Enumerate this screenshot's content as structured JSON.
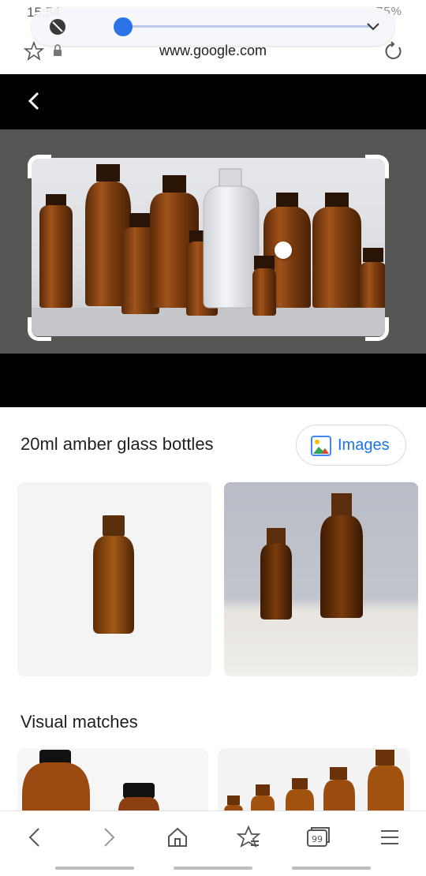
{
  "status_bar": {
    "time": "15:54",
    "battery": "75%"
  },
  "brightness_panel": {
    "level_percent": 2,
    "auto_icon": "auto-brightness-off-icon",
    "expand_icon": "chevron-down-icon"
  },
  "address_bar": {
    "url": "www.google.com",
    "favorite_icon": "star-icon",
    "lock_icon": "lock-icon",
    "reload_icon": "reload-icon"
  },
  "lens": {
    "back_icon": "back-arrow-icon"
  },
  "results": {
    "title": "20ml amber glass bottles",
    "images_button": "Images",
    "visual_matches_title": "Visual matches"
  },
  "bottom_nav": {
    "items": [
      "back-icon",
      "forward-icon",
      "home-icon",
      "bookmarks-icon",
      "tabs-icon",
      "menu-icon"
    ],
    "tab_count": "99"
  },
  "colors": {
    "accent": "#1a73e8",
    "slider": "#2c73ea",
    "amber": "#8a4512"
  }
}
